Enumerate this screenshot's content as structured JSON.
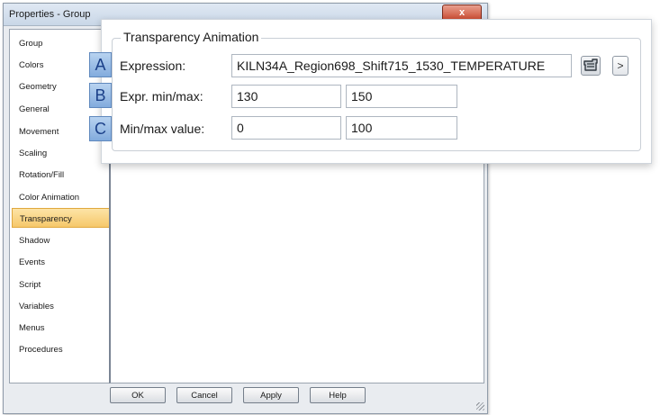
{
  "dialog": {
    "title": "Properties - Group",
    "close_label": "x"
  },
  "nav": {
    "items": [
      {
        "label": "Group"
      },
      {
        "label": "Colors"
      },
      {
        "label": "Geometry"
      },
      {
        "label": "General"
      },
      {
        "label": "Movement"
      },
      {
        "label": "Scaling"
      },
      {
        "label": "Rotation/Fill"
      },
      {
        "label": "Color Animation"
      },
      {
        "label": "Transparency"
      },
      {
        "label": "Shadow"
      },
      {
        "label": "Events"
      },
      {
        "label": "Script"
      },
      {
        "label": "Variables"
      },
      {
        "label": "Menus"
      },
      {
        "label": "Procedures"
      }
    ],
    "selected": "Transparency"
  },
  "buttons": {
    "ok": "OK",
    "cancel": "Cancel",
    "apply": "Apply",
    "help": "Help"
  },
  "transparency": {
    "group_title": "Transparency Animation",
    "rows": [
      {
        "badge": "A",
        "label": "Expression:",
        "value": "KILN34A_Region698_Shift715_1530_TEMPERATURE"
      },
      {
        "badge": "B",
        "label": "Expr. min/max:",
        "min": "130",
        "max": "150"
      },
      {
        "badge": "C",
        "label": "Min/max value:",
        "min": "0",
        "max": "100"
      }
    ],
    "browse_label": ">"
  }
}
